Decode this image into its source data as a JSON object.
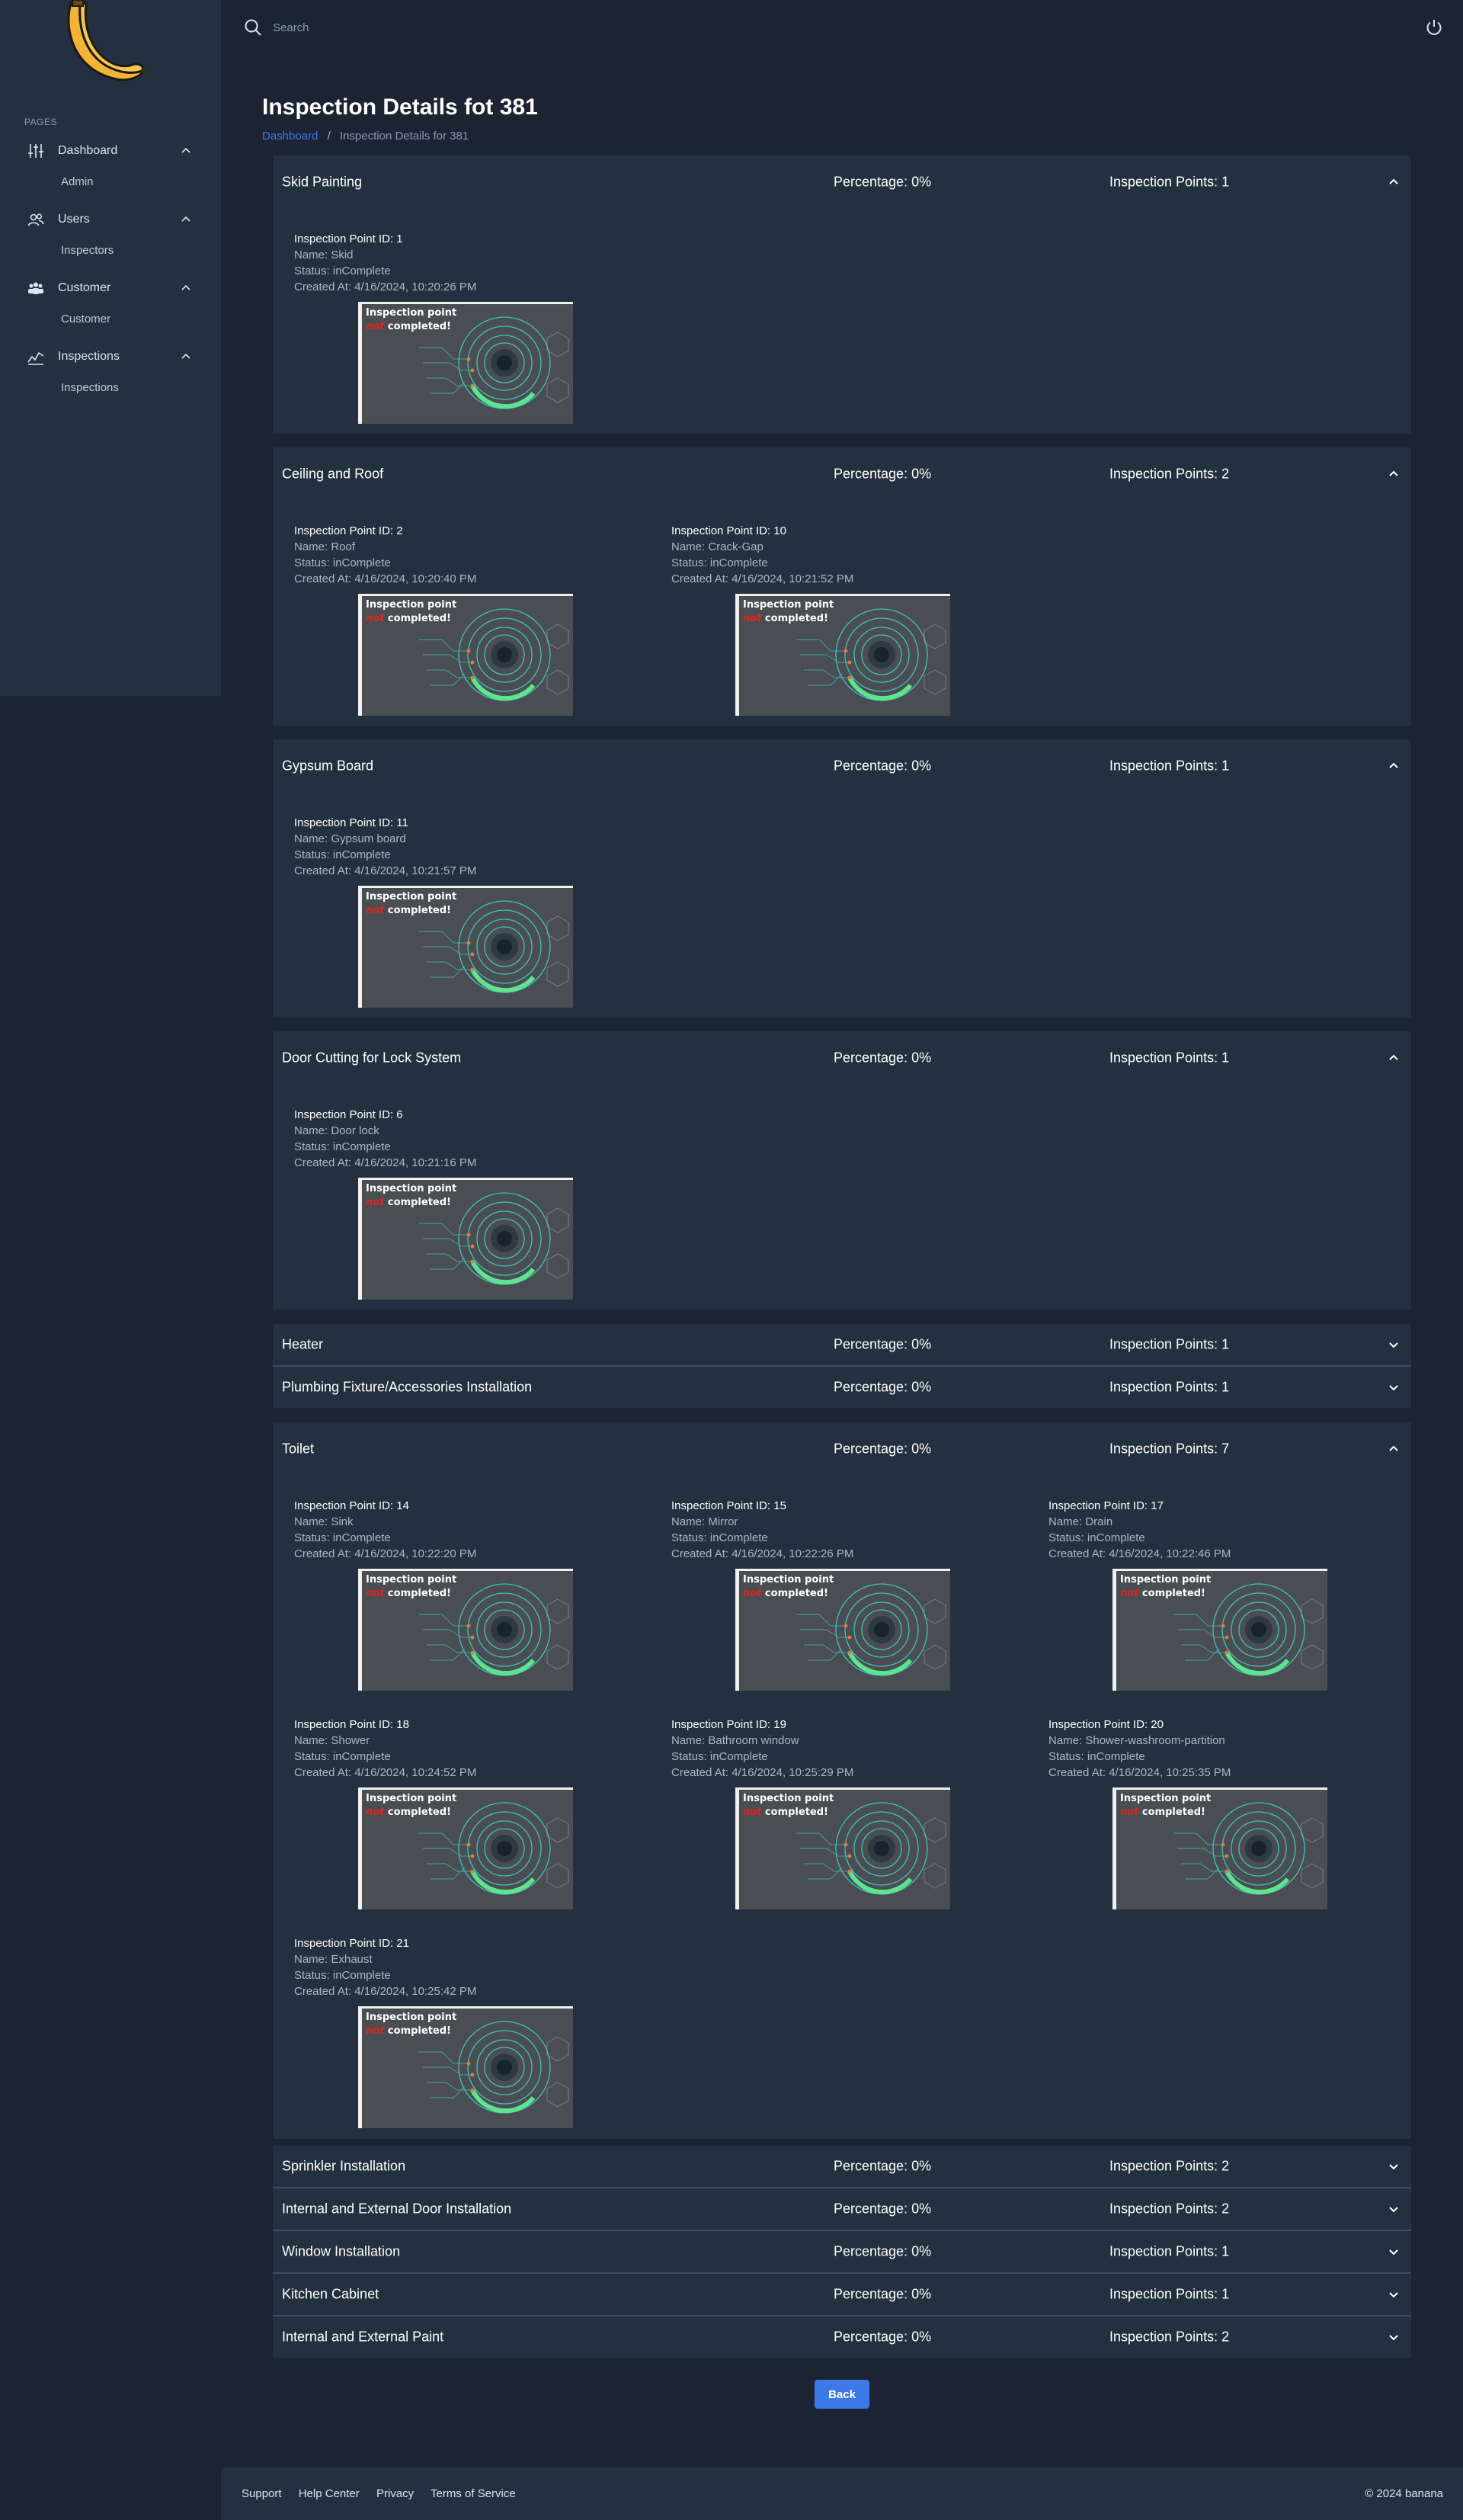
{
  "sidebar": {
    "section_label": "PAGES",
    "groups": [
      {
        "label": "Dashboard",
        "icon": "sliders-icon",
        "sub": "Admin"
      },
      {
        "label": "Users",
        "icon": "users-icon",
        "sub": "Inspectors"
      },
      {
        "label": "Customer",
        "icon": "customers-icon",
        "sub": "Customer"
      },
      {
        "label": "Inspections",
        "icon": "chart-icon",
        "sub": "Inspections"
      }
    ]
  },
  "topbar": {
    "search_placeholder": "Search"
  },
  "page": {
    "title": "Inspection Details fot 381",
    "breadcrumb_home": "Dashboard",
    "breadcrumb_sep": "/",
    "breadcrumb_current": "Inspection Details for 381"
  },
  "image_caption": {
    "line1": "Inspection point",
    "not": "not",
    "line2": " completed!"
  },
  "sections": [
    {
      "title": "Skid Painting",
      "percentage": "Percentage: 0%",
      "points": "Inspection Points: 1",
      "expanded": true,
      "items": [
        {
          "id": "Inspection Point ID: 1",
          "name": "Name: Skid",
          "status": "Status: inComplete",
          "created": "Created At: 4/16/2024, 10:20:26 PM"
        }
      ]
    },
    {
      "title": "Ceiling and Roof",
      "percentage": "Percentage: 0%",
      "points": "Inspection Points: 2",
      "expanded": true,
      "items": [
        {
          "id": "Inspection Point ID: 2",
          "name": "Name: Roof",
          "status": "Status: inComplete",
          "created": "Created At: 4/16/2024, 10:20:40 PM"
        },
        {
          "id": "Inspection Point ID: 10",
          "name": "Name: Crack-Gap",
          "status": "Status: inComplete",
          "created": "Created At: 4/16/2024, 10:21:52 PM"
        }
      ]
    },
    {
      "title": "Gypsum Board",
      "percentage": "Percentage: 0%",
      "points": "Inspection Points: 1",
      "expanded": true,
      "items": [
        {
          "id": "Inspection Point ID: 11",
          "name": "Name: Gypsum board",
          "status": "Status: inComplete",
          "created": "Created At: 4/16/2024, 10:21:57 PM"
        }
      ]
    },
    {
      "title": "Door Cutting for Lock System",
      "percentage": "Percentage: 0%",
      "points": "Inspection Points: 1",
      "expanded": true,
      "items": [
        {
          "id": "Inspection Point ID: 6",
          "name": "Name: Door lock",
          "status": "Status: inComplete",
          "created": "Created At: 4/16/2024, 10:21:16 PM"
        }
      ]
    },
    {
      "title": "Heater",
      "percentage": "Percentage: 0%",
      "points": "Inspection Points: 1",
      "expanded": false,
      "items": []
    },
    {
      "title": "Plumbing Fixture/Accessories Installation",
      "percentage": "Percentage: 0%",
      "points": "Inspection Points: 1",
      "expanded": false,
      "items": []
    },
    {
      "title": "Toilet",
      "percentage": "Percentage: 0%",
      "points": "Inspection Points: 7",
      "expanded": true,
      "items": [
        {
          "id": "Inspection Point ID: 14",
          "name": "Name: Sink",
          "status": "Status: inComplete",
          "created": "Created At: 4/16/2024, 10:22:20 PM"
        },
        {
          "id": "Inspection Point ID: 15",
          "name": "Name: Mirror",
          "status": "Status: inComplete",
          "created": "Created At: 4/16/2024, 10:22:26 PM"
        },
        {
          "id": "Inspection Point ID: 17",
          "name": "Name: Drain",
          "status": "Status: inComplete",
          "created": "Created At: 4/16/2024, 10:22:46 PM"
        },
        {
          "id": "Inspection Point ID: 18",
          "name": "Name: Shower",
          "status": "Status: inComplete",
          "created": "Created At: 4/16/2024, 10:24:52 PM"
        },
        {
          "id": "Inspection Point ID: 19",
          "name": "Name: Bathroom window",
          "status": "Status: inComplete",
          "created": "Created At: 4/16/2024, 10:25:29 PM"
        },
        {
          "id": "Inspection Point ID: 20",
          "name": "Name: Shower-washroom-partition",
          "status": "Status: inComplete",
          "created": "Created At: 4/16/2024, 10:25:35 PM"
        },
        {
          "id": "Inspection Point ID: 21",
          "name": "Name: Exhaust",
          "status": "Status: inComplete",
          "created": "Created At: 4/16/2024, 10:25:42 PM"
        }
      ]
    },
    {
      "title": "Sprinkler Installation",
      "percentage": "Percentage: 0%",
      "points": "Inspection Points: 2",
      "expanded": false,
      "items": []
    },
    {
      "title": "Internal and External Door Installation",
      "percentage": "Percentage: 0%",
      "points": "Inspection Points: 2",
      "expanded": false,
      "items": []
    },
    {
      "title": "Window Installation",
      "percentage": "Percentage: 0%",
      "points": "Inspection Points: 1",
      "expanded": false,
      "items": []
    },
    {
      "title": "Kitchen Cabinet",
      "percentage": "Percentage: 0%",
      "points": "Inspection Points: 1",
      "expanded": false,
      "items": []
    },
    {
      "title": "Internal and External Paint",
      "percentage": "Percentage: 0%",
      "points": "Inspection Points: 2",
      "expanded": false,
      "items": []
    }
  ],
  "back_label": "Back",
  "footer": {
    "links": [
      "Support",
      "Help Center",
      "Privacy",
      "Terms of Service"
    ],
    "copyright": "© 2024 banana"
  },
  "colors": {
    "background": "#1c2434",
    "panel": "#24303f",
    "accent": "#3c78e6",
    "muted_text": "#aeb7c0",
    "caption_not": "#e2231a"
  }
}
